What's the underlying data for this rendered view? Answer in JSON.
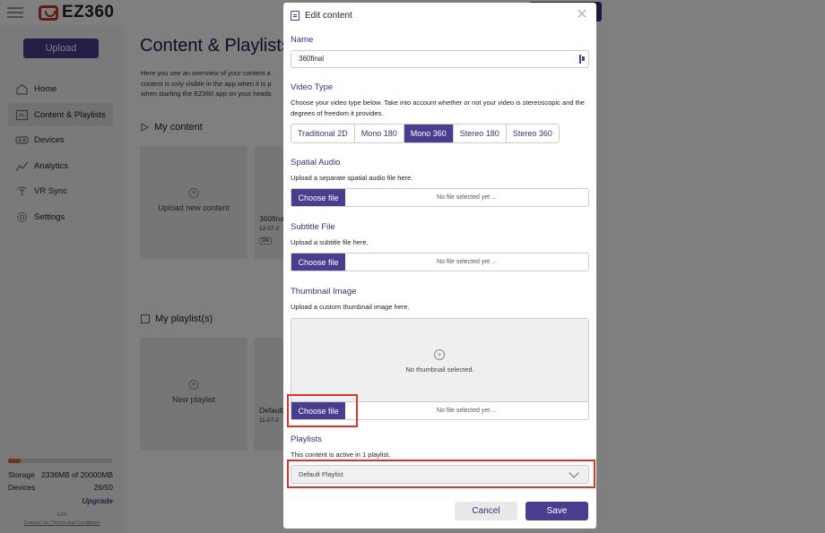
{
  "app": {
    "logo_text": "EZ360",
    "upload_label": "Upload"
  },
  "sidebar": {
    "items": [
      {
        "label": "Home",
        "icon": "home-icon"
      },
      {
        "label": "Content & Playlists",
        "icon": "content-icon"
      },
      {
        "label": "Devices",
        "icon": "devices-icon"
      },
      {
        "label": "Analytics",
        "icon": "analytics-icon"
      },
      {
        "label": "VR Sync",
        "icon": "vr-sync-icon"
      },
      {
        "label": "Settings",
        "icon": "settings-icon"
      }
    ],
    "storage_label": "Storage",
    "storage_value": "2336MB of 20000MB",
    "storage_fraction": 0.1168,
    "devices_label": "Devices",
    "devices_value": "26/50",
    "upgrade_label": "Upgrade",
    "footer_brand": "EZ3",
    "footer_links": "Contact Us | Terms and Conditions"
  },
  "main": {
    "title": "Content & Playlists",
    "intro_lines": [
      "Here you see an overview of your content a",
      "content is only visible in the app when it is p",
      "when starting the EZ360 app on your heads"
    ],
    "my_content_title": "My content",
    "upload_new_label": "Upload new content",
    "content_card": {
      "name": "360fina",
      "date": "12-07-2",
      "tag": "De"
    },
    "playlists_title": "My playlist(s)",
    "new_playlist_label": "New playlist",
    "playlist_card": {
      "name": "Default",
      "date": "11-07-2"
    }
  },
  "modal": {
    "title": "Edit content",
    "name_label": "Name",
    "name_value": "360final",
    "video_type_label": "Video Type",
    "video_type_desc": "Choose your video type below. Take into account whether or not your video is stereoscopic and the degrees of freedom it provides.",
    "video_types": [
      "Traditional 2D",
      "Mono 180",
      "Mono 360",
      "Stereo 180",
      "Stereo 360"
    ],
    "video_type_selected": "Mono 360",
    "spatial_audio_label": "Spatial Audio",
    "spatial_audio_desc": "Upload a separate spatial audio file here.",
    "subtitle_label": "Subtitle File",
    "subtitle_desc": "Upload a subtitle file here.",
    "thumbnail_label": "Thumbnail Image",
    "thumbnail_desc": "Upload a custom thumbnail image here.",
    "no_thumbnail": "No thumbnail selected.",
    "choose_file_label": "Choose file",
    "no_file_text": "No file selected yet ...",
    "playlists_label": "Playlists",
    "playlists_desc": "This content is active in 1 playlist.",
    "playlist_selected": "Default Playlist",
    "cancel_label": "Cancel",
    "save_label": "Save"
  },
  "colors": {
    "accent": "#4a3d8f",
    "highlight": "#d9362b",
    "storage_fill": "#e0663a"
  }
}
